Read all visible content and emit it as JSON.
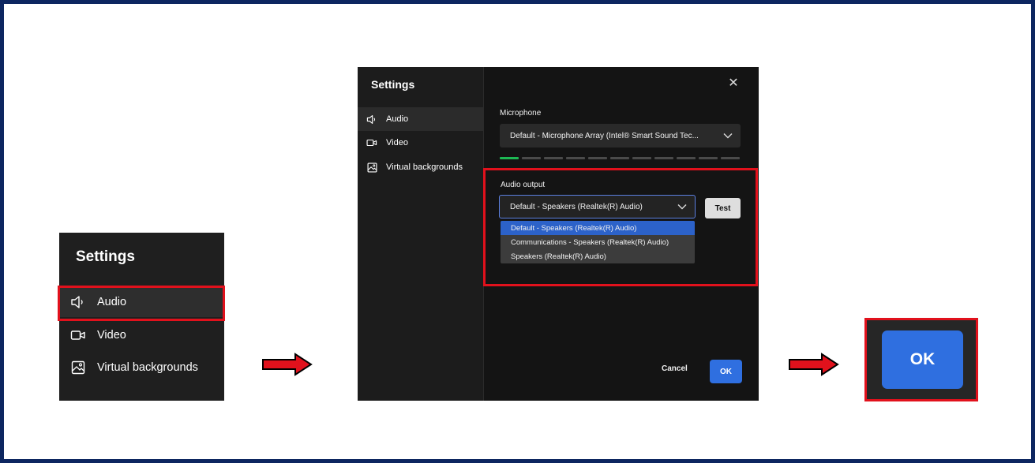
{
  "left_panel": {
    "title": "Settings",
    "items": [
      {
        "label": "Audio",
        "icon": "speaker-icon",
        "selected": true
      },
      {
        "label": "Video",
        "icon": "camera-icon",
        "selected": false
      },
      {
        "label": "Virtual backgrounds",
        "icon": "image-icon",
        "selected": false
      }
    ]
  },
  "dialog": {
    "title": "Settings",
    "nav": [
      {
        "label": "Audio",
        "icon": "speaker-icon",
        "selected": true
      },
      {
        "label": "Video",
        "icon": "camera-icon",
        "selected": false
      },
      {
        "label": "Virtual backgrounds",
        "icon": "image-icon",
        "selected": false
      }
    ],
    "close_label": "✕",
    "microphone": {
      "label": "Microphone",
      "value": "Default - Microphone Array (Intel® Smart Sound Tec...",
      "level_segments_total": 11,
      "level_segments_active": 1
    },
    "audio_output": {
      "label": "Audio output",
      "value": "Default - Speakers (Realtek(R) Audio)",
      "test_label": "Test",
      "options": [
        {
          "label": "Default - Speakers (Realtek(R) Audio)",
          "selected": true
        },
        {
          "label": "Communications - Speakers (Realtek(R) Audio)",
          "selected": false
        },
        {
          "label": "Speakers (Realtek(R) Audio)",
          "selected": false
        }
      ]
    },
    "cancel_label": "Cancel",
    "ok_label": "OK"
  },
  "zoom_ok": {
    "label": "OK"
  },
  "colors": {
    "frame_border": "#0d2660",
    "highlight_red": "#e1111c",
    "accent_blue": "#2f6fe0",
    "meter_active": "#1db954",
    "meter_idle": "#4a4a4a"
  }
}
